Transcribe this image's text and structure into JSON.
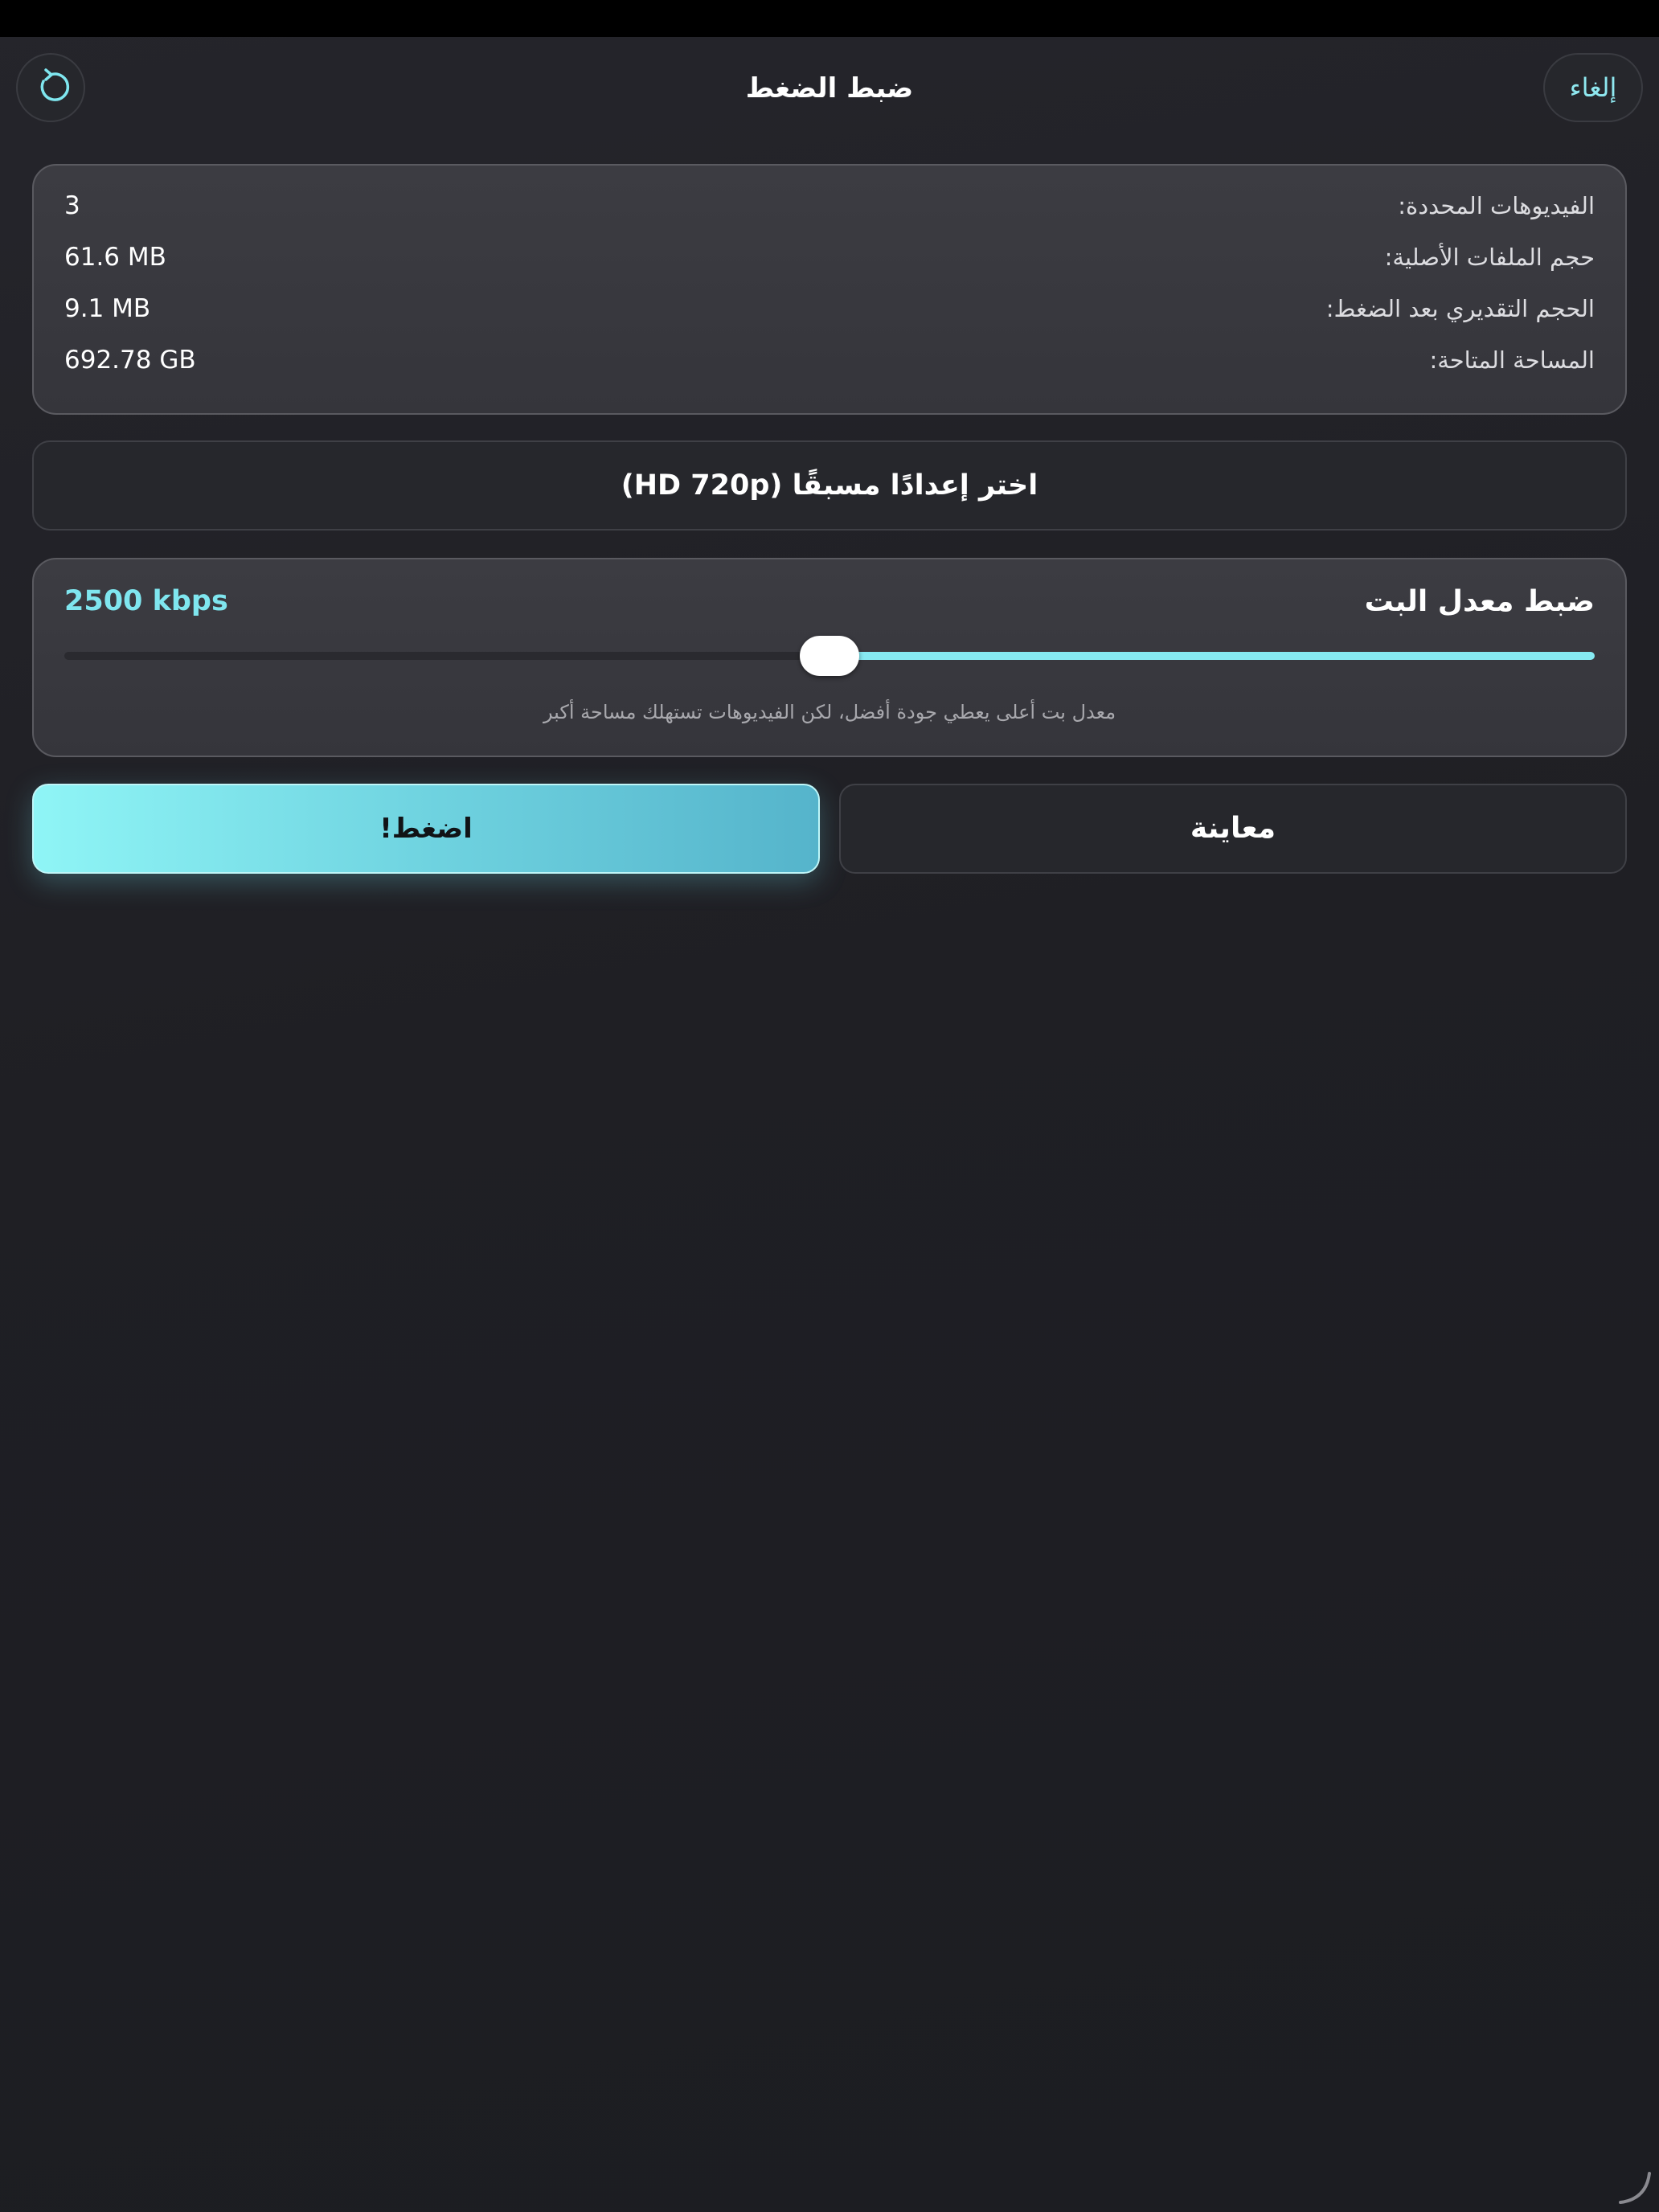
{
  "nav": {
    "title": "ضبط الضغط",
    "cancel_label": "إلغاء",
    "reset_icon": "reset-arrow-icon"
  },
  "info": {
    "rows": [
      {
        "label": "الفيديوهات المحددة:",
        "value": "3"
      },
      {
        "label": "حجم الملفات الأصلية:",
        "value": "61.6 MB"
      },
      {
        "label": "الحجم التقديري بعد الضغط:",
        "value": "9.1 MB"
      },
      {
        "label": "المساحة المتاحة:",
        "value": "692.78 GB"
      }
    ]
  },
  "preset": {
    "label": "اختر إعدادًا مسبقًا (HD 720p)"
  },
  "bitrate": {
    "title": "ضبط معدل البت",
    "value_label": "2500 kbps",
    "level": 0.5,
    "hint": "معدل بت أعلى يعطي جودة أفضل، لكن الفيديوهات تستهلك مساحة أكبر"
  },
  "actions": {
    "compress_label": "اضغط!",
    "preview_label": "معاينة"
  },
  "colors": {
    "accent": "#7fe6ef",
    "background": "#1f1f24",
    "card": "#38383e"
  }
}
